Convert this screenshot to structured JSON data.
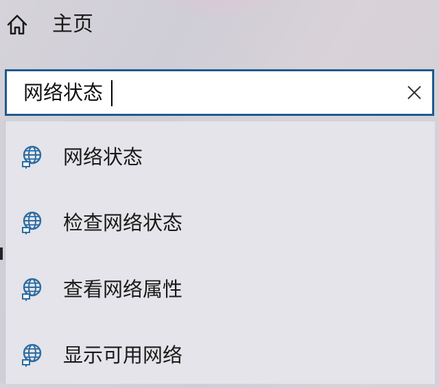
{
  "header": {
    "title": "主页",
    "home_icon": "home-icon"
  },
  "search": {
    "value": "网络状态",
    "placeholder": "",
    "clear_icon": "close-icon"
  },
  "suggestions": [
    {
      "label": "网络状态",
      "icon": "globe-network-icon"
    },
    {
      "label": "检查网络状态",
      "icon": "globe-network-icon"
    },
    {
      "label": "查看网络属性",
      "icon": "globe-network-icon"
    },
    {
      "label": "显示可用网络",
      "icon": "globe-network-icon"
    }
  ],
  "colors": {
    "accent": "#1c5a8e",
    "icon": "#2b6ca3",
    "dropdown_bg": "#e4e4ea"
  }
}
